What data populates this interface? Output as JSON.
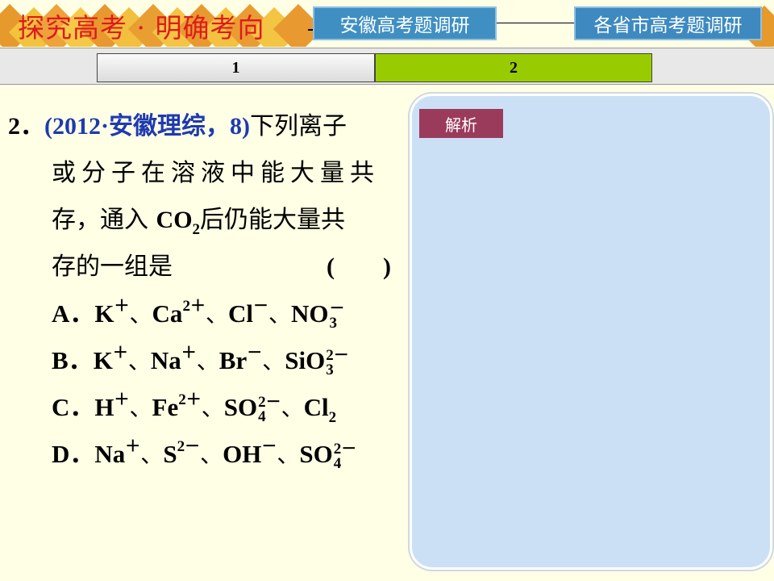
{
  "header": {
    "title": "探究高考 · 明确考向",
    "btn_anhui": "安徽高考题调研",
    "btn_provinces": "各省市高考题调研"
  },
  "tabs": [
    {
      "label": "1"
    },
    {
      "label": "2"
    }
  ],
  "question": {
    "number": "2．",
    "source": "(2012·安徽理综，8)",
    "line1_rest": "下列离子",
    "line2": "或分子在溶液中能大量共",
    "line3_a": "存，通入",
    "co2": "CO",
    "co2_sub": "2",
    "line3_b": "后仍能大量共",
    "line4": "存的一组是",
    "paren": "(　　)"
  },
  "options": {
    "A": {
      "label": "A．",
      "ions": [
        {
          "base": "K",
          "sup": "＋"
        },
        {
          "base": "Ca",
          "sup": "2＋"
        },
        {
          "base": "Cl",
          "sup": "－"
        },
        {
          "base": "NO",
          "sup": "－",
          "sub": "3"
        }
      ]
    },
    "B": {
      "label": "B．",
      "ions": [
        {
          "base": "K",
          "sup": "＋"
        },
        {
          "base": "Na",
          "sup": "＋"
        },
        {
          "base": "Br",
          "sup": "－"
        },
        {
          "base": "SiO",
          "sup": "2－",
          "sub": "3"
        }
      ]
    },
    "C": {
      "label": "C．",
      "ions": [
        {
          "base": "H",
          "sup": "＋"
        },
        {
          "base": "Fe",
          "sup": "2＋"
        },
        {
          "base": "SO",
          "sup": "2－",
          "sub": "4"
        },
        {
          "base": "Cl",
          "sub": "2"
        }
      ]
    },
    "D": {
      "label": "D．",
      "ions": [
        {
          "base": "Na",
          "sup": "＋"
        },
        {
          "base": "S",
          "sup": "2－"
        },
        {
          "base": "OH",
          "sup": "－"
        },
        {
          "base": "SO",
          "sup": "2－",
          "sub": "4"
        }
      ]
    },
    "separator": "、"
  },
  "panel": {
    "analysis_label": "解析"
  },
  "colors": {
    "title": "#E0191E",
    "source": "#1E3AB0",
    "tab_active": "#99CC00",
    "panel": "#CCE0F5",
    "analysis_btn": "#9B3B5C",
    "header_btn": "#3F8FC2"
  }
}
